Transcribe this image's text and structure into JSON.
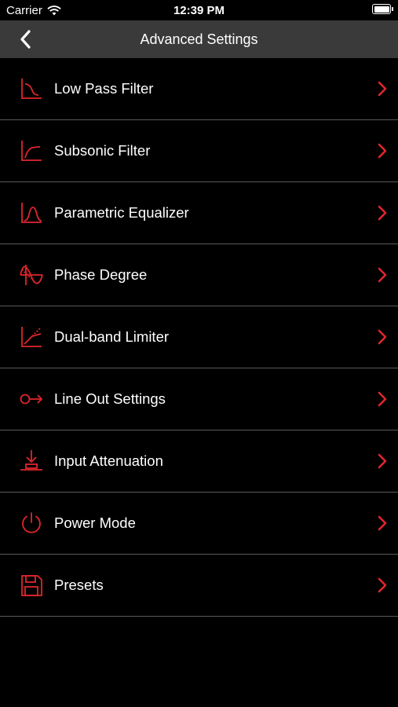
{
  "status_bar": {
    "carrier": "Carrier",
    "time": "12:39 PM"
  },
  "nav": {
    "title": "Advanced Settings"
  },
  "colors": {
    "accent": "#e0262b",
    "nav_background": "#3a3a3a",
    "divider": "#5a5a5a"
  },
  "menu": [
    {
      "label": "Low Pass Filter",
      "icon": "low-pass-filter-icon"
    },
    {
      "label": "Subsonic Filter",
      "icon": "subsonic-filter-icon"
    },
    {
      "label": "Parametric Equalizer",
      "icon": "parametric-equalizer-icon"
    },
    {
      "label": "Phase Degree",
      "icon": "phase-degree-icon"
    },
    {
      "label": "Dual-band Limiter",
      "icon": "dual-band-limiter-icon"
    },
    {
      "label": "Line Out Settings",
      "icon": "line-out-icon"
    },
    {
      "label": "Input Attenuation",
      "icon": "input-attenuation-icon"
    },
    {
      "label": "Power Mode",
      "icon": "power-icon"
    },
    {
      "label": "Presets",
      "icon": "save-icon"
    }
  ]
}
